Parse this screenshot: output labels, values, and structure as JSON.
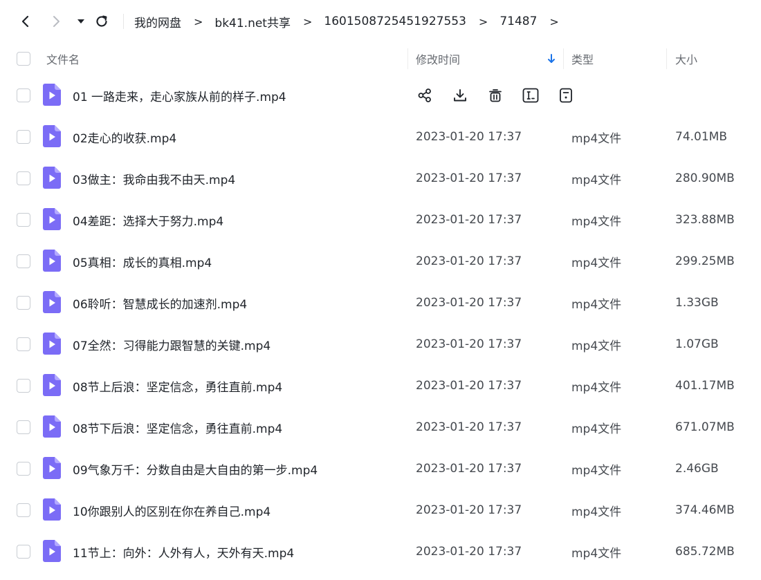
{
  "breadcrumb": [
    "我的网盘",
    "bk41.net共享",
    "1601508725451927553",
    "71487"
  ],
  "columns": {
    "name": "文件名",
    "modified": "修改时间",
    "type": "类型",
    "size": "大小"
  },
  "sort_indicator": "arrow-down-icon",
  "accent_color": "#1a73e8",
  "file_icon_color": "#7b6cf6",
  "row_actions": [
    "share-icon",
    "download-icon",
    "delete-icon",
    "rename-icon",
    "more-icon"
  ],
  "files": [
    {
      "name": "01 一路走来，走心家族从前的样子.mp4",
      "modified": "",
      "type": "",
      "size": ""
    },
    {
      "name": "02走心的收获.mp4",
      "modified": "2023-01-20 17:37",
      "type": "mp4文件",
      "size": "74.01MB"
    },
    {
      "name": "03做主：我命由我不由天.mp4",
      "modified": "2023-01-20 17:37",
      "type": "mp4文件",
      "size": "280.90MB"
    },
    {
      "name": "04差距：选择大于努力.mp4",
      "modified": "2023-01-20 17:37",
      "type": "mp4文件",
      "size": "323.88MB"
    },
    {
      "name": "05真相：成长的真相.mp4",
      "modified": "2023-01-20 17:37",
      "type": "mp4文件",
      "size": "299.25MB"
    },
    {
      "name": "06聆听：智慧成长的加速剂.mp4",
      "modified": "2023-01-20 17:37",
      "type": "mp4文件",
      "size": "1.33GB"
    },
    {
      "name": "07全然：习得能力跟智慧的关键.mp4",
      "modified": "2023-01-20 17:37",
      "type": "mp4文件",
      "size": "1.07GB"
    },
    {
      "name": "08节上后浪：坚定信念，勇往直前.mp4",
      "modified": "2023-01-20 17:37",
      "type": "mp4文件",
      "size": "401.17MB"
    },
    {
      "name": "08节下后浪：坚定信念，勇往直前.mp4",
      "modified": "2023-01-20 17:37",
      "type": "mp4文件",
      "size": "671.07MB"
    },
    {
      "name": "09气象万千：分数自由是大自由的第一步.mp4",
      "modified": "2023-01-20 17:37",
      "type": "mp4文件",
      "size": "2.46GB"
    },
    {
      "name": "10你跟别人的区别在你在养自己.mp4",
      "modified": "2023-01-20 17:37",
      "type": "mp4文件",
      "size": "374.46MB"
    },
    {
      "name": "11节上：向外：人外有人，天外有天.mp4",
      "modified": "2023-01-20 17:37",
      "type": "mp4文件",
      "size": "685.72MB"
    }
  ]
}
